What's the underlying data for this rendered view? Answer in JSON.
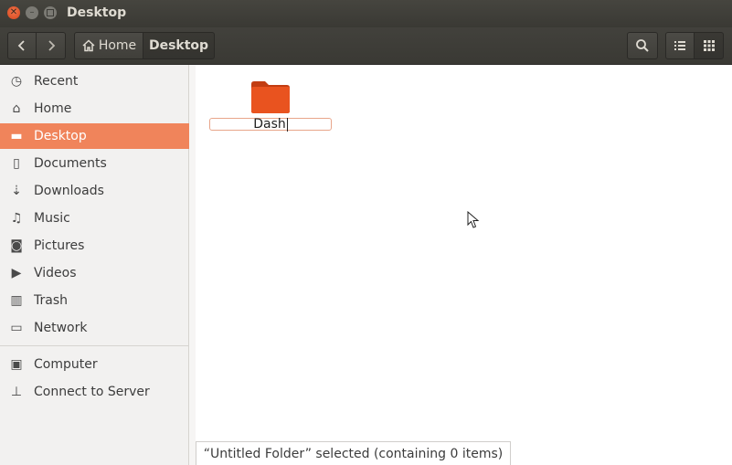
{
  "window": {
    "title": "Desktop"
  },
  "toolbar": {
    "breadcrumb": [
      {
        "label": "Home",
        "icon": "home-icon"
      },
      {
        "label": "Desktop"
      }
    ]
  },
  "sidebar": {
    "items": [
      {
        "label": "Recent",
        "icon": "clock-icon"
      },
      {
        "label": "Home",
        "icon": "home-icon"
      },
      {
        "label": "Desktop",
        "icon": "folder-icon",
        "active": true
      },
      {
        "label": "Documents",
        "icon": "document-icon"
      },
      {
        "label": "Downloads",
        "icon": "download-icon"
      },
      {
        "label": "Music",
        "icon": "music-icon"
      },
      {
        "label": "Pictures",
        "icon": "camera-icon"
      },
      {
        "label": "Videos",
        "icon": "video-icon"
      },
      {
        "label": "Trash",
        "icon": "trash-icon"
      },
      {
        "label": "Network",
        "icon": "network-icon"
      }
    ],
    "devices": [
      {
        "label": "Computer",
        "icon": "computer-icon"
      },
      {
        "label": "Connect to Server",
        "icon": "server-icon"
      }
    ]
  },
  "main": {
    "folder": {
      "rename_value": "Dash",
      "icon": "folder-icon",
      "color": "#e9531f"
    }
  },
  "statusbar": {
    "text": "“Untitled Folder” selected  (containing 0 items)"
  },
  "colors": {
    "accent": "#f0845b",
    "titlebar": "#3c3b37"
  }
}
